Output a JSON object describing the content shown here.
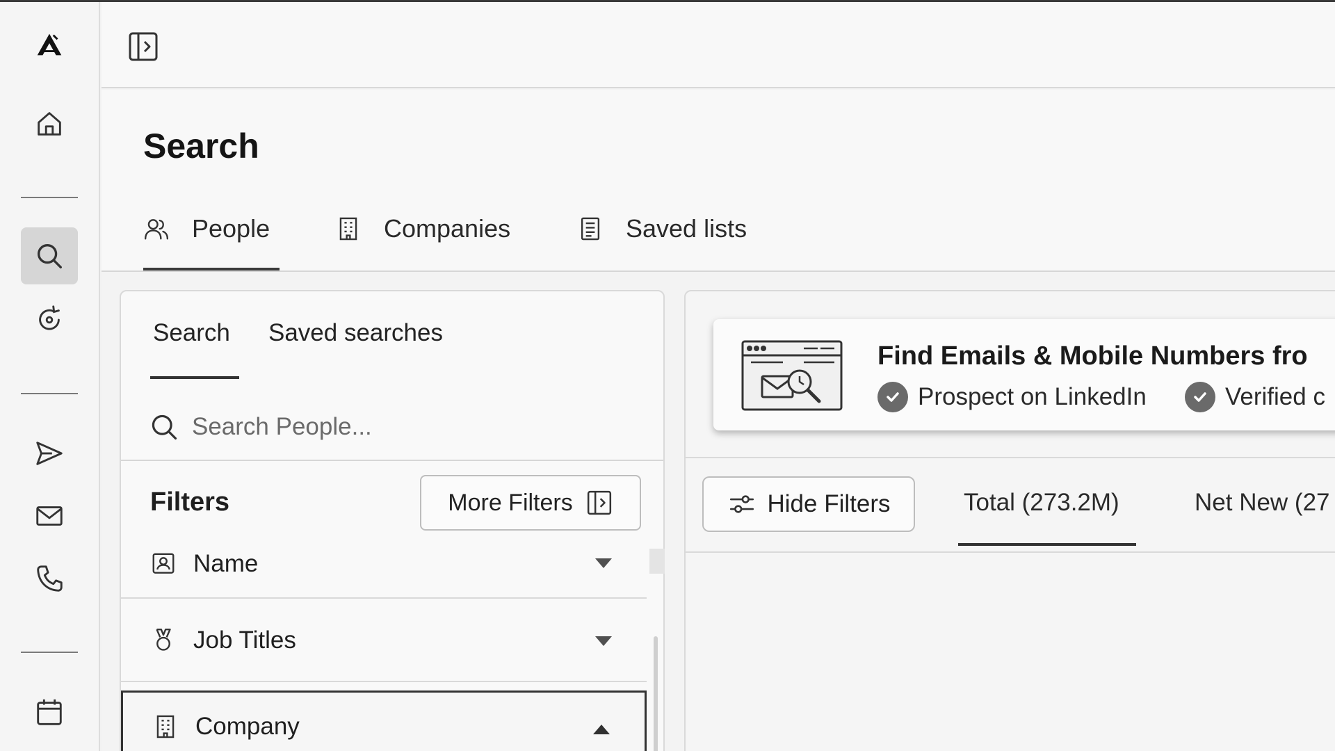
{
  "sidebar": {
    "items": [
      {
        "name": "logo",
        "icon": "app-logo-icon"
      },
      {
        "name": "home",
        "icon": "home-icon"
      },
      {
        "name": "search",
        "icon": "search-icon",
        "active": true
      },
      {
        "name": "sequences",
        "icon": "refresh-cycle-icon"
      },
      {
        "name": "outreach",
        "icon": "send-icon"
      },
      {
        "name": "inbox",
        "icon": "mail-icon"
      },
      {
        "name": "calls",
        "icon": "phone-icon"
      },
      {
        "name": "calendar",
        "icon": "calendar-icon"
      }
    ]
  },
  "header": {
    "panel_toggle_icon": "sidebar-expand-icon"
  },
  "page": {
    "title": "Search",
    "tabs": [
      {
        "label": "People",
        "icon": "people-icon",
        "active": true
      },
      {
        "label": "Companies",
        "icon": "building-icon"
      },
      {
        "label": "Saved lists",
        "icon": "list-icon"
      }
    ]
  },
  "filter_panel": {
    "sub_tabs": [
      {
        "label": "Search",
        "active": true
      },
      {
        "label": "Saved searches"
      }
    ],
    "search_placeholder": "Search People...",
    "filters_title": "Filters",
    "more_filters_label": "More Filters",
    "filters": [
      {
        "label": "Name",
        "icon": "contact-card-icon",
        "expanded": false
      },
      {
        "label": "Job Titles",
        "icon": "badge-award-icon",
        "expanded": false
      },
      {
        "label": "Company",
        "icon": "building-icon",
        "expanded": true
      }
    ]
  },
  "results_panel": {
    "promo": {
      "title": "Find Emails & Mobile Numbers fro",
      "checks": [
        "Prospect on LinkedIn",
        "Verified c"
      ],
      "illustration": "email-search-illustration"
    },
    "hide_filters_label": "Hide Filters",
    "count_tabs": [
      {
        "label": "Total (273.2M)",
        "active": true
      },
      {
        "label": "Net New (27"
      }
    ]
  }
}
